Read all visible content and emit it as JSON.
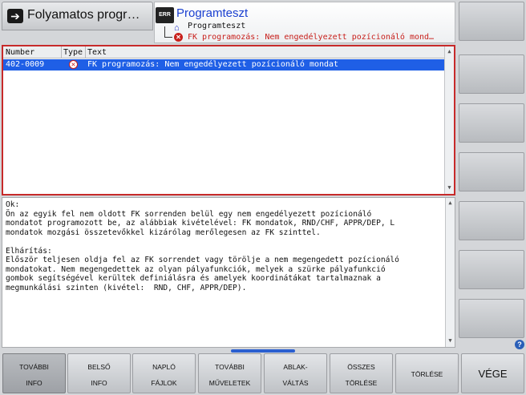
{
  "mode_tab": {
    "label": "Folyamatos progr…",
    "icon": "operating-mode-icon"
  },
  "program_header": {
    "badge": "ERR",
    "title": "Programteszt",
    "tree_item": "Programteszt",
    "error_line": "FK programozás: Nem engedélyezett pozícionáló mond…"
  },
  "error_table": {
    "columns": [
      "Number",
      "Type",
      "Text"
    ],
    "rows": [
      {
        "number": "402-0009",
        "type_icon": "error-icon",
        "text": "FK programozás: Nem engedélyezett pozícionáló mondat"
      }
    ]
  },
  "description": {
    "lines": [
      "Ok:",
      "Ön az egyik fel nem oldott FK sorrenden belül egy nem engedélyezett pozícionáló",
      "mondatot programozott be, az alábbiak kivételével: FK mondatok, RND/CHF, APPR/DEP, L",
      "mondatok mozgási összetevőkkel kizárólag merőlegesen az FK szinttel.",
      "",
      "Elhárítás:",
      "Először teljesen oldja fel az FK sorrendet vagy törölje a nem megengedett pozícionáló",
      "mondatokat. Nem megengedettek az olyan pályafunkciók, melyek a szürke pályafunkció",
      "gombok segítségével kerültek definiálásra és amelyek koordinátákat tartalmaznak a",
      "megmunkálási szinten (kivétel:  RND, CHF, APPR/DEP)."
    ]
  },
  "softkeys": [
    {
      "l1": "TOVÁBBI",
      "l2": "INFO"
    },
    {
      "l1": "BELSŐ",
      "l2": "INFO"
    },
    {
      "l1": "NAPLÓ",
      "l2": "FÁJLOK"
    },
    {
      "l1": "TOVÁBBI",
      "l2": "MŰVELETEK"
    },
    {
      "l1": "ABLAK-",
      "l2": "VÁLTÁS"
    },
    {
      "l1": "ÖSSZES",
      "l2": "TÖRLÉSE"
    },
    {
      "l1": "TÖRLÉSE",
      "l2": ""
    },
    {
      "l1": "VÉGE",
      "l2": ""
    }
  ],
  "colors": {
    "accent": "#1f5fe6",
    "error": "#c8201c",
    "panel_border": "#c72a2a"
  }
}
